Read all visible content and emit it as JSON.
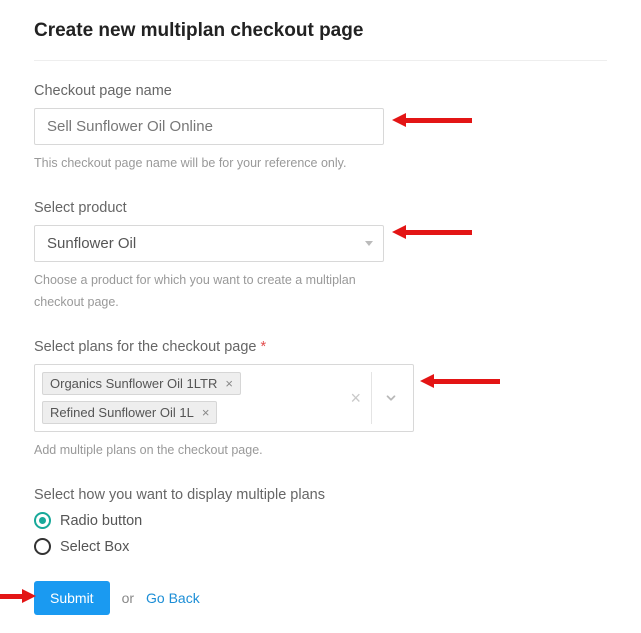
{
  "title": "Create new multiplan checkout page",
  "checkoutName": {
    "label": "Checkout page name",
    "value": "Sell Sunflower Oil Online",
    "helper": "This checkout page name will be for your reference only."
  },
  "product": {
    "label": "Select product",
    "value": "Sunflower Oil",
    "helper": "Choose a product for which you want to create a multiplan checkout page."
  },
  "plans": {
    "label": "Select plans for the checkout page",
    "chips": [
      "Organics Sunflower Oil 1LTR",
      "Refined Sunflower Oil 1L"
    ],
    "helper": "Add multiple plans on the checkout page."
  },
  "display": {
    "label": "Select how you want to display multiple plans",
    "options": [
      "Radio button",
      "Select Box"
    ],
    "selected": "Radio button"
  },
  "actions": {
    "submit": "Submit",
    "or": "or",
    "goBack": "Go Back"
  }
}
